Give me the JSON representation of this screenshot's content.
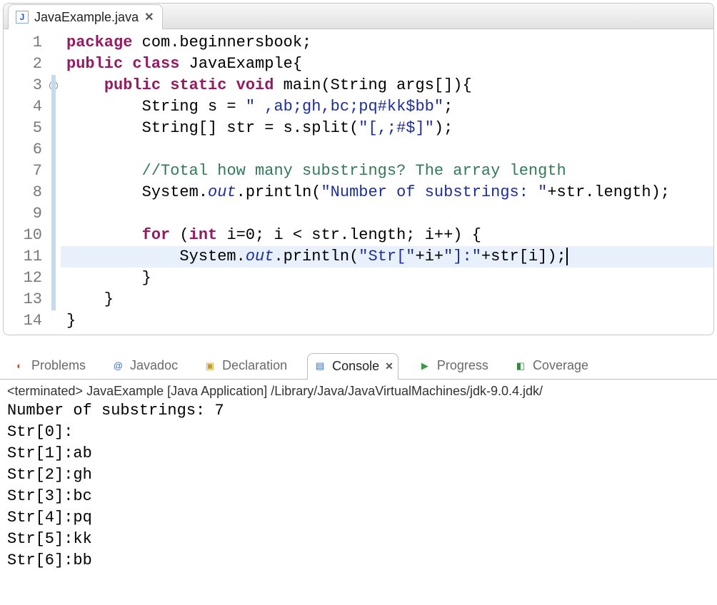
{
  "editor": {
    "tab": {
      "label": "JavaExample.java"
    },
    "lines": [
      {
        "n": "1",
        "html": "<span class=\"kw\">package</span> com.beginnersbook;"
      },
      {
        "n": "2",
        "html": "<span class=\"kw\">public</span> <span class=\"kw\">class</span> JavaExample{"
      },
      {
        "n": "3",
        "html": "    <span class=\"kw\">public</span> <span class=\"kw\">static</span> <span class=\"kw\">void</span> main(String args[]){",
        "fold": true
      },
      {
        "n": "4",
        "html": "        String s = <span class=\"str\">\" ,ab;gh,bc;pq#kk$bb\"</span>;"
      },
      {
        "n": "5",
        "html": "        String[] str = s.split(<span class=\"str\">\"[,;#$]\"</span>);"
      },
      {
        "n": "6",
        "html": ""
      },
      {
        "n": "7",
        "html": "        <span class=\"cmt\">//Total how many substrings? The array length</span>"
      },
      {
        "n": "8",
        "html": "        System.<span class=\"fld\">out</span>.println(<span class=\"str\">\"Number of substrings: \"</span>+str.length);"
      },
      {
        "n": "9",
        "html": ""
      },
      {
        "n": "10",
        "html": "        <span class=\"kw\">for</span> (<span class=\"kw\">int</span> i=0; i &lt; str.length; i++) {"
      },
      {
        "n": "11",
        "html": "            System.<span class=\"fld\">out</span>.println(<span class=\"str\">\"Str[\"</span>+i+<span class=\"str\">\"]:\"</span>+str[i]);<span class=\"cursor\"></span>",
        "highlight": true
      },
      {
        "n": "12",
        "html": "        }"
      },
      {
        "n": "13",
        "html": "    }"
      },
      {
        "n": "14",
        "html": "}"
      }
    ],
    "marker_ranges": [
      {
        "from": 3,
        "to": 13
      }
    ]
  },
  "views": {
    "problems": "Problems",
    "javadoc": "Javadoc",
    "declaration": "Declaration",
    "console": "Console",
    "progress": "Progress",
    "coverage": "Coverage"
  },
  "console": {
    "status": "<terminated> JavaExample [Java Application] /Library/Java/JavaVirtualMachines/jdk-9.0.4.jdk/",
    "lines": [
      "Number of substrings: 7",
      "Str[0]:",
      "Str[1]:ab",
      "Str[2]:gh",
      "Str[3]:bc",
      "Str[4]:pq",
      "Str[5]:kk",
      "Str[6]:bb"
    ]
  }
}
